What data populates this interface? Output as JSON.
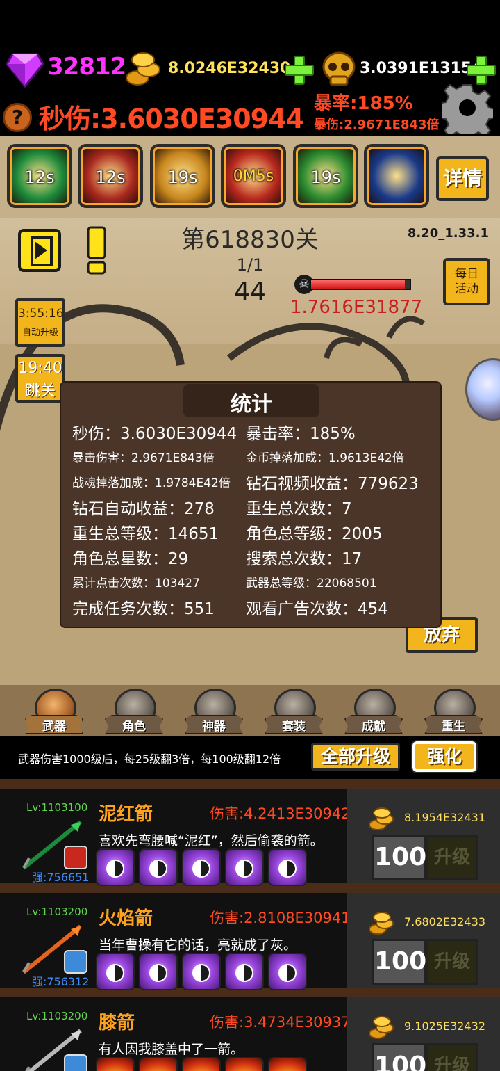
{
  "resources": {
    "gems": "32812",
    "gold": "8.0246E32430",
    "souls": "3.0391E13154",
    "help": "?",
    "dps": "秒伤:3.6030E30944",
    "crit_rate": "暴率:185%",
    "crit_damage": "暴伤:2.9671E843倍"
  },
  "skills": [
    {
      "cd": "12s",
      "color": "#1c8a3a"
    },
    {
      "cd": "12s",
      "color": "#a8281e"
    },
    {
      "cd": "19s",
      "color": "#c8861e"
    },
    {
      "cd": "0M5s",
      "color": "#b8281e",
      "highlight": true
    },
    {
      "cd": "19s",
      "color": "#2a8a2e"
    },
    {
      "cd": "",
      "color": "#1a3a8a"
    }
  ],
  "detail_label": "详情",
  "stage": {
    "level": "第618830关",
    "version": "8.20_1.33.1",
    "wave": "1/1",
    "enemies": "44",
    "boss_hp": "1.7616E31877",
    "hp_fraction": 0.95
  },
  "side_buttons": {
    "daily_line1": "每日",
    "daily_line2": "活动",
    "auto_time": "3:55:16",
    "auto_label": "自动升级",
    "skip_time": "19:40",
    "skip_label": "跳关",
    "give_up": "放弃"
  },
  "stats": {
    "title": "统计",
    "items": [
      {
        "text": "秒伤：3.6030E30944",
        "size": "big"
      },
      {
        "text": "暴击率：185%",
        "size": "big"
      },
      {
        "text": "暴击伤害：2.9671E843倍",
        "size": "small"
      },
      {
        "text": "金币掉落加成：1.9613E42倍",
        "size": "small"
      },
      {
        "text": "战魂掉落加成：1.9784E42倍",
        "size": "small"
      },
      {
        "text": "钻石视频收益：779623",
        "size": "big"
      },
      {
        "text": "钻石自动收益：278",
        "size": "big"
      },
      {
        "text": "重生总次数：7",
        "size": "big"
      },
      {
        "text": "重生总等级：14651",
        "size": "big"
      },
      {
        "text": "角色总等级：2005",
        "size": "big"
      },
      {
        "text": "角色总星数：29",
        "size": "big"
      },
      {
        "text": "搜索总次数：17",
        "size": "big"
      },
      {
        "text": "累计点击次数：103427",
        "size": "small"
      },
      {
        "text": "武器总等级：22068501",
        "size": "small"
      },
      {
        "text": "完成任务次数：551",
        "size": "big"
      },
      {
        "text": "观看广告次数：454",
        "size": "big"
      }
    ]
  },
  "tabs": [
    {
      "label": "武器",
      "active": true
    },
    {
      "label": "角色",
      "active": false
    },
    {
      "label": "神器",
      "active": false
    },
    {
      "label": "套装",
      "active": false
    },
    {
      "label": "成就",
      "active": false
    },
    {
      "label": "重生",
      "active": false
    }
  ],
  "info": {
    "text": "武器伤害1000级后，每25级翻3倍，每100级翻12倍",
    "upgrade_all": "全部升级",
    "enhance": "强化"
  },
  "weapons": [
    {
      "level": "Lv:1103100",
      "name": "泥红箭",
      "damage": "伤害:4.2413E30942",
      "desc": "喜欢先弯腰喊“泥红”，然后偷袭的箭。",
      "strength": "强:756651",
      "cost": "8.1954E32431",
      "qty": "100",
      "upgrade": "升级",
      "rune": "yinyang",
      "badge_color": "#c8281e"
    },
    {
      "level": "Lv:1103200",
      "name": "火焰箭",
      "damage": "伤害:2.8108E30941",
      "desc": "当年曹操有它的话，亮就成了灰。",
      "strength": "强:756312",
      "cost": "7.6802E32433",
      "qty": "100",
      "upgrade": "升级",
      "rune": "yinyang",
      "badge_color": "#3c8ad8"
    },
    {
      "level": "Lv:1103200",
      "name": "膝箭",
      "damage": "伤害:3.4734E30937",
      "desc": "有人因我膝盖中了一箭。",
      "strength": "",
      "cost": "9.1025E32432",
      "qty": "100",
      "upgrade": "升级",
      "rune": "fire",
      "badge_color": "#3c8ad8"
    }
  ]
}
